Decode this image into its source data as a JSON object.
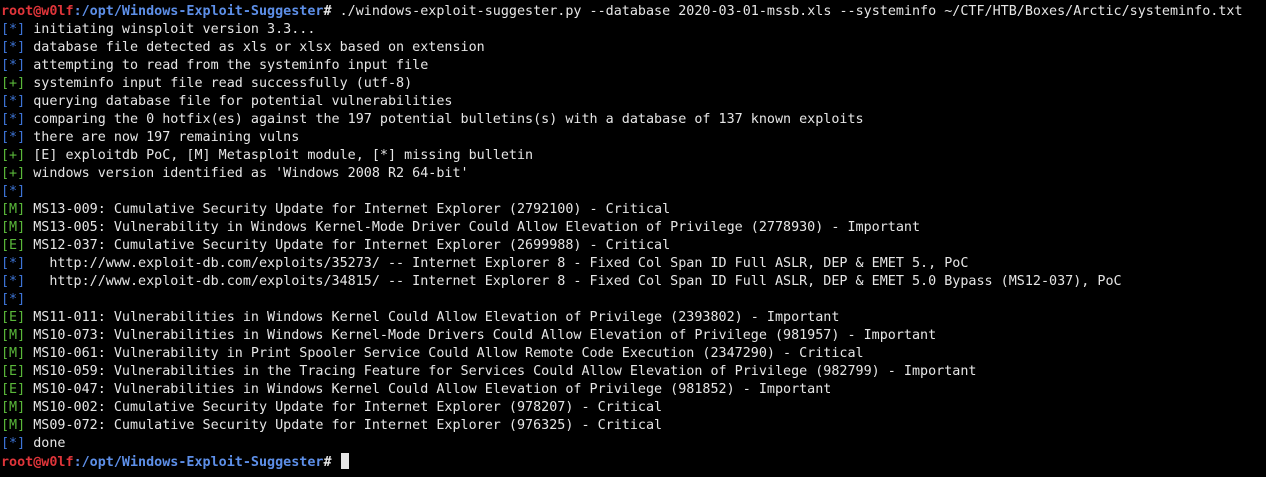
{
  "colors": {
    "background": "#000000",
    "text": "#e6e6e6",
    "tag_info": "#3d74d6",
    "tag_success": "#5ab83a",
    "prompt_user": "#e0353a",
    "prompt_path": "#5d8fe8"
  },
  "prompt": {
    "user_host": "root@w0lf",
    "path": ":/opt/Windows-Exploit-Suggester",
    "symbol": "# "
  },
  "command": "./windows-exploit-suggester.py --database 2020-03-01-mssb.xls --systeminfo ~/CTF/HTB/Boxes/Arctic/systeminfo.txt",
  "output": [
    {
      "tag": "[*]",
      "kind": "info",
      "text": " initiating winsploit version 3.3..."
    },
    {
      "tag": "[*]",
      "kind": "info",
      "text": " database file detected as xls or xlsx based on extension"
    },
    {
      "tag": "[*]",
      "kind": "info",
      "text": " attempting to read from the systeminfo input file"
    },
    {
      "tag": "[+]",
      "kind": "success",
      "text": " systeminfo input file read successfully (utf-8)"
    },
    {
      "tag": "[*]",
      "kind": "info",
      "text": " querying database file for potential vulnerabilities"
    },
    {
      "tag": "[*]",
      "kind": "info",
      "text": " comparing the 0 hotfix(es) against the 197 potential bulletins(s) with a database of 137 known exploits"
    },
    {
      "tag": "[*]",
      "kind": "info",
      "text": " there are now 197 remaining vulns"
    },
    {
      "tag": "[+]",
      "kind": "success",
      "text": " [E] exploitdb PoC, [M] Metasploit module, [*] missing bulletin"
    },
    {
      "tag": "[+]",
      "kind": "success",
      "text": " windows version identified as 'Windows 2008 R2 64-bit'"
    },
    {
      "tag": "[*]",
      "kind": "info",
      "text": ""
    },
    {
      "tag": "[M]",
      "kind": "success",
      "text": " MS13-009: Cumulative Security Update for Internet Explorer (2792100) - Critical"
    },
    {
      "tag": "[M]",
      "kind": "success",
      "text": " MS13-005: Vulnerability in Windows Kernel-Mode Driver Could Allow Elevation of Privilege (2778930) - Important"
    },
    {
      "tag": "[E]",
      "kind": "success",
      "text": " MS12-037: Cumulative Security Update for Internet Explorer (2699988) - Critical"
    },
    {
      "tag": "[*]",
      "kind": "info",
      "text": "   http://www.exploit-db.com/exploits/35273/ -- Internet Explorer 8 - Fixed Col Span ID Full ASLR, DEP & EMET 5., PoC"
    },
    {
      "tag": "[*]",
      "kind": "info",
      "text": "   http://www.exploit-db.com/exploits/34815/ -- Internet Explorer 8 - Fixed Col Span ID Full ASLR, DEP & EMET 5.0 Bypass (MS12-037), PoC"
    },
    {
      "tag": "[*]",
      "kind": "info",
      "text": ""
    },
    {
      "tag": "[E]",
      "kind": "success",
      "text": " MS11-011: Vulnerabilities in Windows Kernel Could Allow Elevation of Privilege (2393802) - Important"
    },
    {
      "tag": "[M]",
      "kind": "success",
      "text": " MS10-073: Vulnerabilities in Windows Kernel-Mode Drivers Could Allow Elevation of Privilege (981957) - Important"
    },
    {
      "tag": "[M]",
      "kind": "success",
      "text": " MS10-061: Vulnerability in Print Spooler Service Could Allow Remote Code Execution (2347290) - Critical"
    },
    {
      "tag": "[E]",
      "kind": "success",
      "text": " MS10-059: Vulnerabilities in the Tracing Feature for Services Could Allow Elevation of Privilege (982799) - Important"
    },
    {
      "tag": "[E]",
      "kind": "success",
      "text": " MS10-047: Vulnerabilities in Windows Kernel Could Allow Elevation of Privilege (981852) - Important"
    },
    {
      "tag": "[M]",
      "kind": "success",
      "text": " MS10-002: Cumulative Security Update for Internet Explorer (978207) - Critical"
    },
    {
      "tag": "[M]",
      "kind": "success",
      "text": " MS09-072: Cumulative Security Update for Internet Explorer (976325) - Critical"
    },
    {
      "tag": "[*]",
      "kind": "info",
      "text": " done"
    }
  ]
}
